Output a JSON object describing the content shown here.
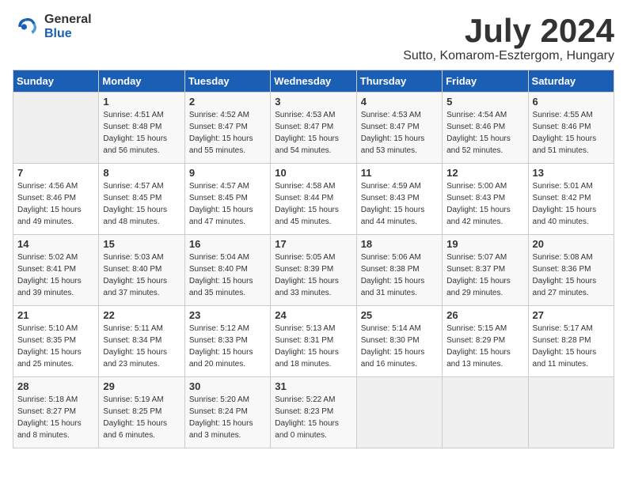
{
  "logo": {
    "general": "General",
    "blue": "Blue"
  },
  "title": {
    "month": "July 2024",
    "location": "Sutto, Komarom-Esztergom, Hungary"
  },
  "calendar": {
    "headers": [
      "Sunday",
      "Monday",
      "Tuesday",
      "Wednesday",
      "Thursday",
      "Friday",
      "Saturday"
    ],
    "rows": [
      [
        {
          "day": "",
          "sunrise": "",
          "sunset": "",
          "daylight": ""
        },
        {
          "day": "1",
          "sunrise": "Sunrise: 4:51 AM",
          "sunset": "Sunset: 8:48 PM",
          "daylight": "Daylight: 15 hours and 56 minutes."
        },
        {
          "day": "2",
          "sunrise": "Sunrise: 4:52 AM",
          "sunset": "Sunset: 8:47 PM",
          "daylight": "Daylight: 15 hours and 55 minutes."
        },
        {
          "day": "3",
          "sunrise": "Sunrise: 4:53 AM",
          "sunset": "Sunset: 8:47 PM",
          "daylight": "Daylight: 15 hours and 54 minutes."
        },
        {
          "day": "4",
          "sunrise": "Sunrise: 4:53 AM",
          "sunset": "Sunset: 8:47 PM",
          "daylight": "Daylight: 15 hours and 53 minutes."
        },
        {
          "day": "5",
          "sunrise": "Sunrise: 4:54 AM",
          "sunset": "Sunset: 8:46 PM",
          "daylight": "Daylight: 15 hours and 52 minutes."
        },
        {
          "day": "6",
          "sunrise": "Sunrise: 4:55 AM",
          "sunset": "Sunset: 8:46 PM",
          "daylight": "Daylight: 15 hours and 51 minutes."
        }
      ],
      [
        {
          "day": "7",
          "sunrise": "Sunrise: 4:56 AM",
          "sunset": "Sunset: 8:46 PM",
          "daylight": "Daylight: 15 hours and 49 minutes."
        },
        {
          "day": "8",
          "sunrise": "Sunrise: 4:57 AM",
          "sunset": "Sunset: 8:45 PM",
          "daylight": "Daylight: 15 hours and 48 minutes."
        },
        {
          "day": "9",
          "sunrise": "Sunrise: 4:57 AM",
          "sunset": "Sunset: 8:45 PM",
          "daylight": "Daylight: 15 hours and 47 minutes."
        },
        {
          "day": "10",
          "sunrise": "Sunrise: 4:58 AM",
          "sunset": "Sunset: 8:44 PM",
          "daylight": "Daylight: 15 hours and 45 minutes."
        },
        {
          "day": "11",
          "sunrise": "Sunrise: 4:59 AM",
          "sunset": "Sunset: 8:43 PM",
          "daylight": "Daylight: 15 hours and 44 minutes."
        },
        {
          "day": "12",
          "sunrise": "Sunrise: 5:00 AM",
          "sunset": "Sunset: 8:43 PM",
          "daylight": "Daylight: 15 hours and 42 minutes."
        },
        {
          "day": "13",
          "sunrise": "Sunrise: 5:01 AM",
          "sunset": "Sunset: 8:42 PM",
          "daylight": "Daylight: 15 hours and 40 minutes."
        }
      ],
      [
        {
          "day": "14",
          "sunrise": "Sunrise: 5:02 AM",
          "sunset": "Sunset: 8:41 PM",
          "daylight": "Daylight: 15 hours and 39 minutes."
        },
        {
          "day": "15",
          "sunrise": "Sunrise: 5:03 AM",
          "sunset": "Sunset: 8:40 PM",
          "daylight": "Daylight: 15 hours and 37 minutes."
        },
        {
          "day": "16",
          "sunrise": "Sunrise: 5:04 AM",
          "sunset": "Sunset: 8:40 PM",
          "daylight": "Daylight: 15 hours and 35 minutes."
        },
        {
          "day": "17",
          "sunrise": "Sunrise: 5:05 AM",
          "sunset": "Sunset: 8:39 PM",
          "daylight": "Daylight: 15 hours and 33 minutes."
        },
        {
          "day": "18",
          "sunrise": "Sunrise: 5:06 AM",
          "sunset": "Sunset: 8:38 PM",
          "daylight": "Daylight: 15 hours and 31 minutes."
        },
        {
          "day": "19",
          "sunrise": "Sunrise: 5:07 AM",
          "sunset": "Sunset: 8:37 PM",
          "daylight": "Daylight: 15 hours and 29 minutes."
        },
        {
          "day": "20",
          "sunrise": "Sunrise: 5:08 AM",
          "sunset": "Sunset: 8:36 PM",
          "daylight": "Daylight: 15 hours and 27 minutes."
        }
      ],
      [
        {
          "day": "21",
          "sunrise": "Sunrise: 5:10 AM",
          "sunset": "Sunset: 8:35 PM",
          "daylight": "Daylight: 15 hours and 25 minutes."
        },
        {
          "day": "22",
          "sunrise": "Sunrise: 5:11 AM",
          "sunset": "Sunset: 8:34 PM",
          "daylight": "Daylight: 15 hours and 23 minutes."
        },
        {
          "day": "23",
          "sunrise": "Sunrise: 5:12 AM",
          "sunset": "Sunset: 8:33 PM",
          "daylight": "Daylight: 15 hours and 20 minutes."
        },
        {
          "day": "24",
          "sunrise": "Sunrise: 5:13 AM",
          "sunset": "Sunset: 8:31 PM",
          "daylight": "Daylight: 15 hours and 18 minutes."
        },
        {
          "day": "25",
          "sunrise": "Sunrise: 5:14 AM",
          "sunset": "Sunset: 8:30 PM",
          "daylight": "Daylight: 15 hours and 16 minutes."
        },
        {
          "day": "26",
          "sunrise": "Sunrise: 5:15 AM",
          "sunset": "Sunset: 8:29 PM",
          "daylight": "Daylight: 15 hours and 13 minutes."
        },
        {
          "day": "27",
          "sunrise": "Sunrise: 5:17 AM",
          "sunset": "Sunset: 8:28 PM",
          "daylight": "Daylight: 15 hours and 11 minutes."
        }
      ],
      [
        {
          "day": "28",
          "sunrise": "Sunrise: 5:18 AM",
          "sunset": "Sunset: 8:27 PM",
          "daylight": "Daylight: 15 hours and 8 minutes."
        },
        {
          "day": "29",
          "sunrise": "Sunrise: 5:19 AM",
          "sunset": "Sunset: 8:25 PM",
          "daylight": "Daylight: 15 hours and 6 minutes."
        },
        {
          "day": "30",
          "sunrise": "Sunrise: 5:20 AM",
          "sunset": "Sunset: 8:24 PM",
          "daylight": "Daylight: 15 hours and 3 minutes."
        },
        {
          "day": "31",
          "sunrise": "Sunrise: 5:22 AM",
          "sunset": "Sunset: 8:23 PM",
          "daylight": "Daylight: 15 hours and 0 minutes."
        },
        {
          "day": "",
          "sunrise": "",
          "sunset": "",
          "daylight": ""
        },
        {
          "day": "",
          "sunrise": "",
          "sunset": "",
          "daylight": ""
        },
        {
          "day": "",
          "sunrise": "",
          "sunset": "",
          "daylight": ""
        }
      ]
    ]
  }
}
